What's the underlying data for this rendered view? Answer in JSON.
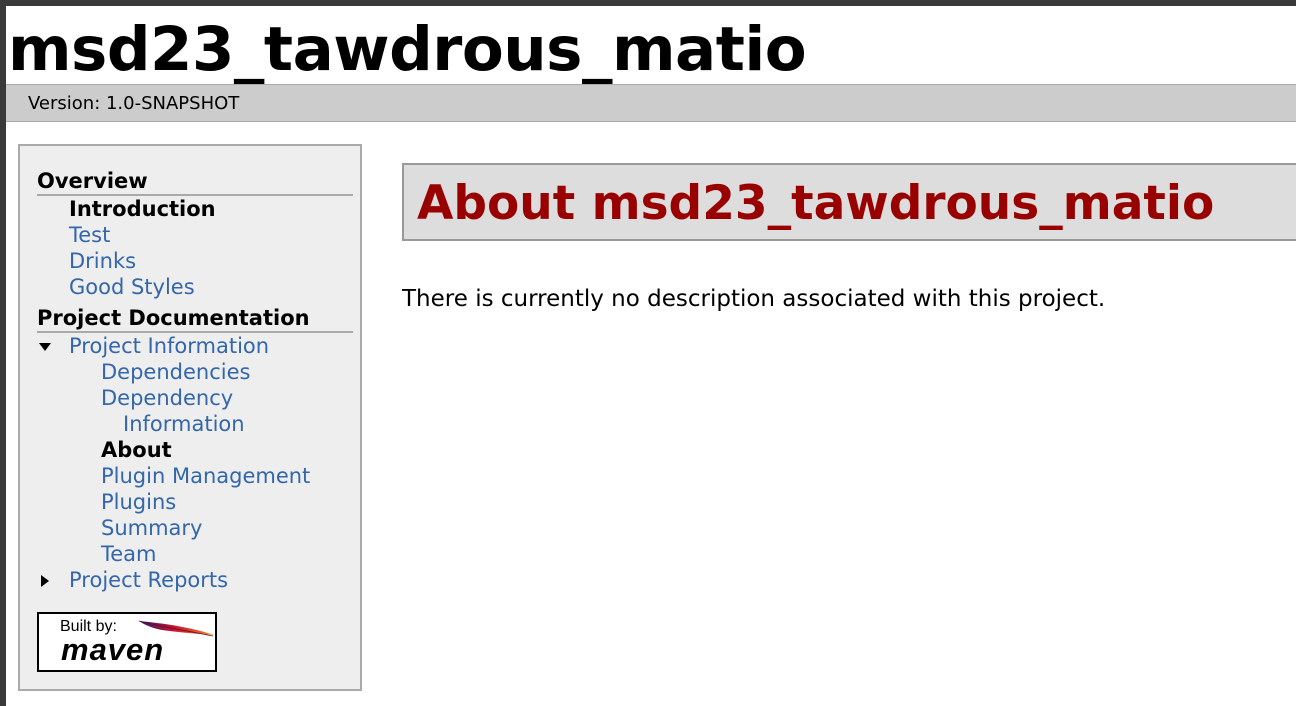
{
  "banner": {
    "title": "msd23_tawdrous_matio"
  },
  "breadcrumbs": {
    "version": "Version: 1.0-SNAPSHOT"
  },
  "navigation": {
    "overview_heading": "Overview",
    "overview_items": [
      "Introduction",
      "Test",
      "Drinks",
      "Good Styles"
    ],
    "project_documentation_heading": "Project Documentation",
    "project_information": {
      "label": "Project Information",
      "expanded": true,
      "items": [
        "Dependencies",
        "Dependency",
        "Information",
        "About",
        "Plugin Management",
        "Plugins",
        "Summary",
        "Team"
      ]
    },
    "project_reports": {
      "label": "Project Reports",
      "expanded": false
    },
    "active_items": [
      "Introduction",
      "About"
    ]
  },
  "powered_by": {
    "built_by": "Built by:",
    "maven": "maven"
  },
  "content": {
    "section_title": "About msd23_tawdrous_matio",
    "description": "There is currently no description associated with this project."
  },
  "colors": {
    "link": "#3366aa",
    "section_title": "#990000",
    "breadcrumbs_bg": "#cccccc",
    "sidebar_bg": "#eeeeee",
    "section_title_bg": "#dddddd"
  }
}
